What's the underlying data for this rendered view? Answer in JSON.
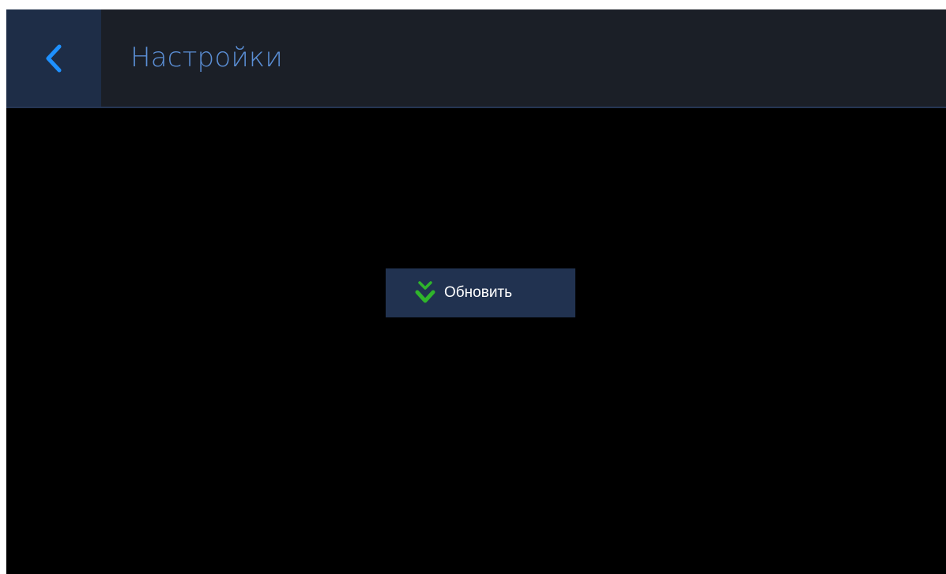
{
  "header": {
    "back_icon": "chevron-left-icon",
    "title": "Настройки"
  },
  "main": {
    "update_button": {
      "icon": "double-chevron-down-icon",
      "label": "Обновить"
    }
  },
  "colors": {
    "screen_background": "#000000",
    "header_background": "#1b1f27",
    "back_button_background": "#1e2d47",
    "back_icon": "#1e90ff",
    "title_text": "#5b8fd6",
    "button_background": "#213250",
    "button_icon": "#2fb52b",
    "button_text": "#ffffff"
  }
}
